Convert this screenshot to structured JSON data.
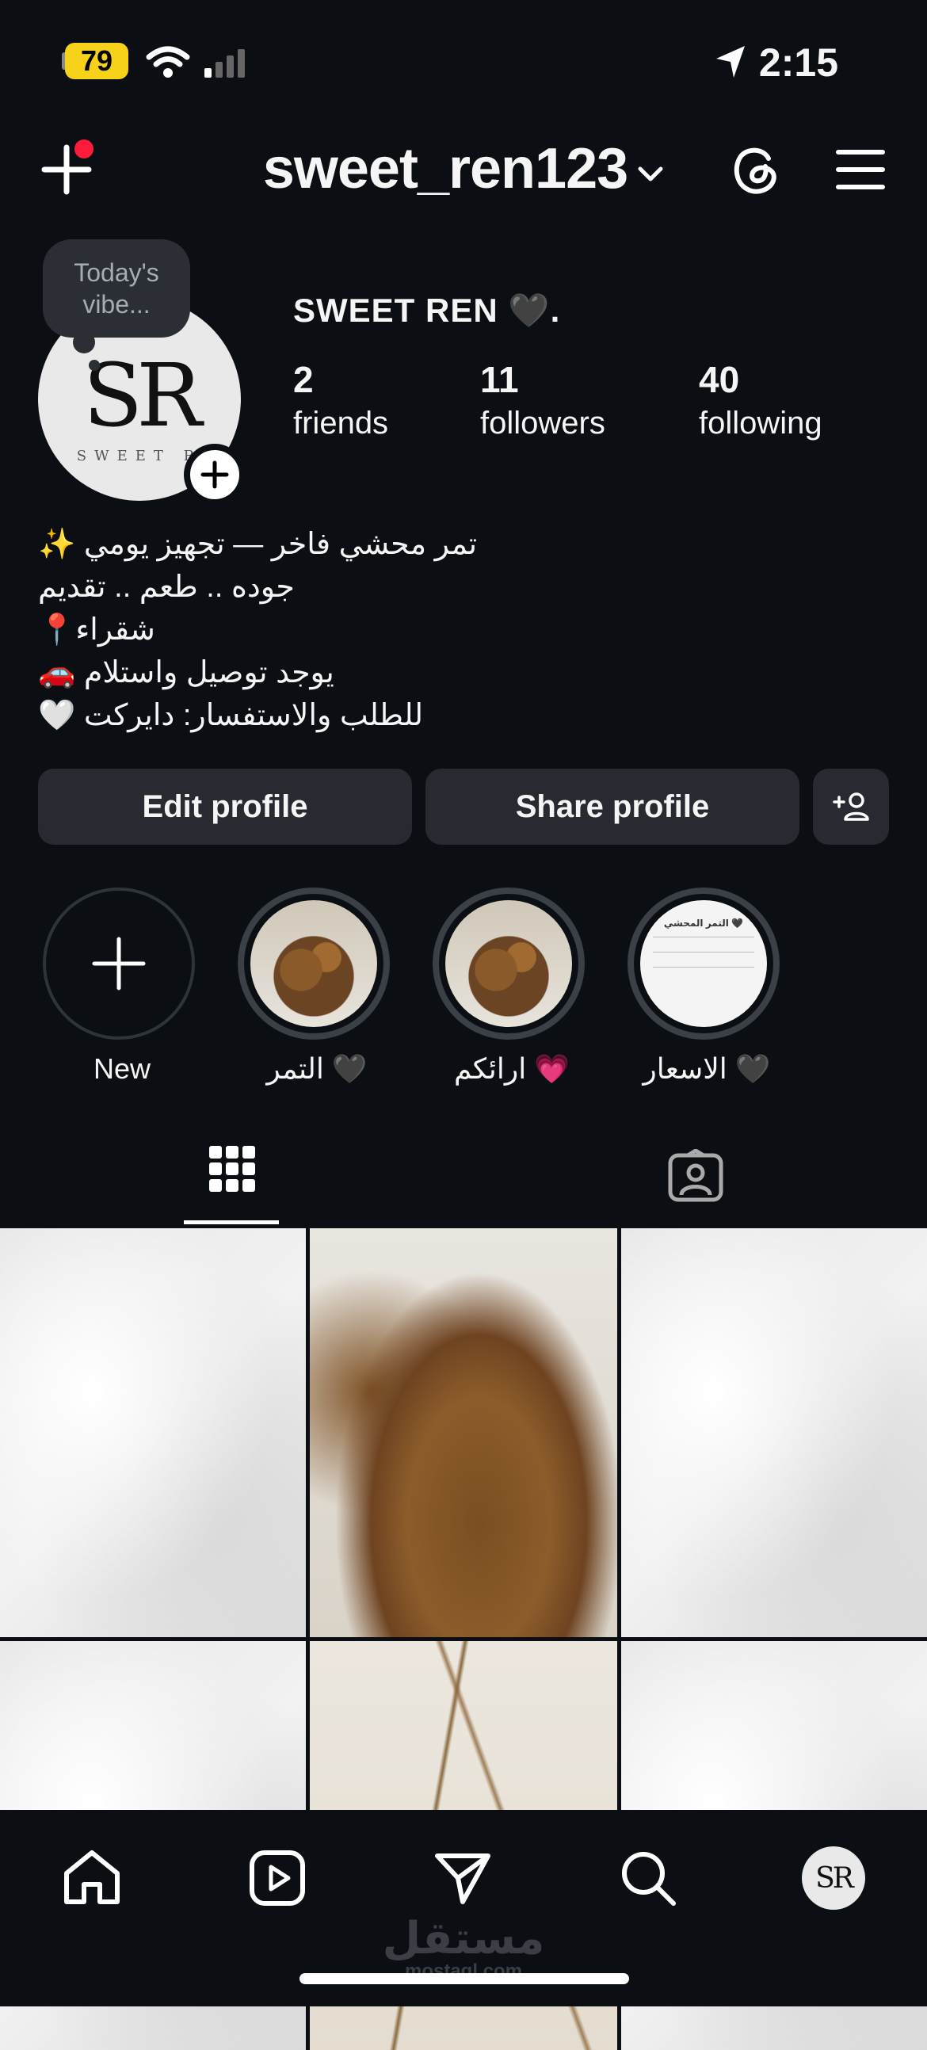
{
  "status_bar": {
    "battery": "79",
    "time": "2:15"
  },
  "header": {
    "username": "sweet_ren123"
  },
  "profile": {
    "note": "Today's vibe...",
    "avatar_text": "SR",
    "avatar_subtext": "SWEET R",
    "display_name": "SWEET REN 🖤.",
    "stats": [
      {
        "num": "2",
        "label": "friends"
      },
      {
        "num": "11",
        "label": "followers"
      },
      {
        "num": "40",
        "label": "following"
      }
    ],
    "bio": [
      "✨ تمر محشي فاخر — تجهيز يومي",
      "جوده .. طعم .. تقديم",
      "📍شقراء",
      "🚗 يوجد توصيل واستلام",
      "🤍 للطلب والاستفسار: دايركت"
    ]
  },
  "buttons": {
    "edit": "Edit profile",
    "share": "Share profile"
  },
  "highlights": [
    {
      "label": "New"
    },
    {
      "label": "التمر 🖤"
    },
    {
      "label": "ارائكم 💗"
    },
    {
      "label": "الاسعار 🖤"
    }
  ],
  "price_card": {
    "title": "التمر المحشي 🖤"
  },
  "watermark": {
    "arabic": "مستقل",
    "latin": "mostaql.com"
  }
}
